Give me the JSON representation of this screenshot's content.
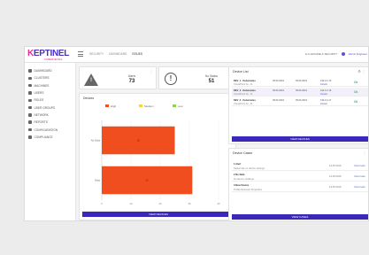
{
  "app": {
    "logo_k": "K",
    "logo_rest": "EPTINEL",
    "logo_sub": "KUBERNETES"
  },
  "topnav": [
    "SECURITY",
    "DASHBOARD",
    "ISSUES"
  ],
  "topright": {
    "org": "LLC-ENGINE & SECURITY",
    "user": "Admin Engineer"
  },
  "sidebar": {
    "items": [
      {
        "label": "DASHBOARD",
        "icon": "dashboard-icon"
      },
      {
        "label": "CLUSTERS",
        "icon": "cluster-icon"
      },
      {
        "label": "MACHINES",
        "icon": "machine-icon"
      },
      {
        "label": "USERS",
        "icon": "users-icon"
      },
      {
        "label": "ROLES",
        "icon": "roles-icon"
      },
      {
        "label": "USER GROUPS",
        "icon": "groups-icon"
      },
      {
        "label": "NETWORK",
        "icon": "network-icon"
      },
      {
        "label": "REPORTS",
        "icon": "reports-icon"
      },
      {
        "label": "CONFIGURATION",
        "icon": "config-icon"
      },
      {
        "label": "COMPLIANCE",
        "icon": "compliance-icon"
      }
    ]
  },
  "stats": [
    {
      "label": "Alerts",
      "value": "73",
      "icon": "warning-icon"
    },
    {
      "label": "No Status",
      "value": "51",
      "icon": "info-circle-icon"
    }
  ],
  "chart_card": {
    "title": "Devices",
    "view_label": "VIEW DEVICES"
  },
  "chart_data": {
    "type": "bar",
    "orientation": "horizontal",
    "title": "Devices",
    "categories": [
      "No Data",
      "Data"
    ],
    "legend": [
      "High",
      "Medium",
      "Low"
    ],
    "legend_colors": [
      "#f04e1e",
      "#f5d53a",
      "#8fd14f"
    ],
    "series": [
      {
        "name": "High",
        "values": [
          25,
          31
        ]
      }
    ],
    "data_labels": [
      "25",
      "31"
    ],
    "xlim": [
      0,
      40
    ],
    "xticks": [
      "0",
      "10",
      "20",
      "30",
      "40"
    ],
    "grid": true,
    "legend_position": "top"
  },
  "devices": {
    "title": "Device List",
    "rows": [
      {
        "name": "DEV_1 - Kubernetes",
        "sub": "CheckPoint fw - 11",
        "date1": "05.06.2019",
        "date2": "05.06.2019",
        "ip": "192.0.2.15",
        "link": "Details",
        "status": "Ok",
        "alt": false
      },
      {
        "name": "DEV_2 - Kubernetes",
        "sub": "CheckPoint fw - 11",
        "date1": "05.06.2019",
        "date2": "05.06.2019",
        "ip": "192.0.2.16",
        "link": "Details",
        "status": "Ok",
        "alt": true
      },
      {
        "name": "DEV_3 - Kubernetes",
        "sub": "CheckPoint fw - 11",
        "date1": "05.06.2019",
        "date2": "05.06.2019",
        "ip": "192.0.2.17",
        "link": "Details",
        "status": "Ok",
        "alt": false
      }
    ],
    "button": "VIEW DEVICES"
  },
  "cases": {
    "title": "Device Cases",
    "rows": [
      {
        "title": "1 Alert",
        "desc": "Failed rule on device settings",
        "date": "14.05.2019",
        "link": "View Case"
      },
      {
        "title": "2 No Data",
        "desc": "No device readings",
        "date": "14.05.2019",
        "link": "View Case"
      },
      {
        "title": "3 New Device",
        "desc": "Profile Relevant Properties",
        "date": "13.05.2019",
        "link": "View Case"
      }
    ],
    "button": "VIEW CASES"
  }
}
